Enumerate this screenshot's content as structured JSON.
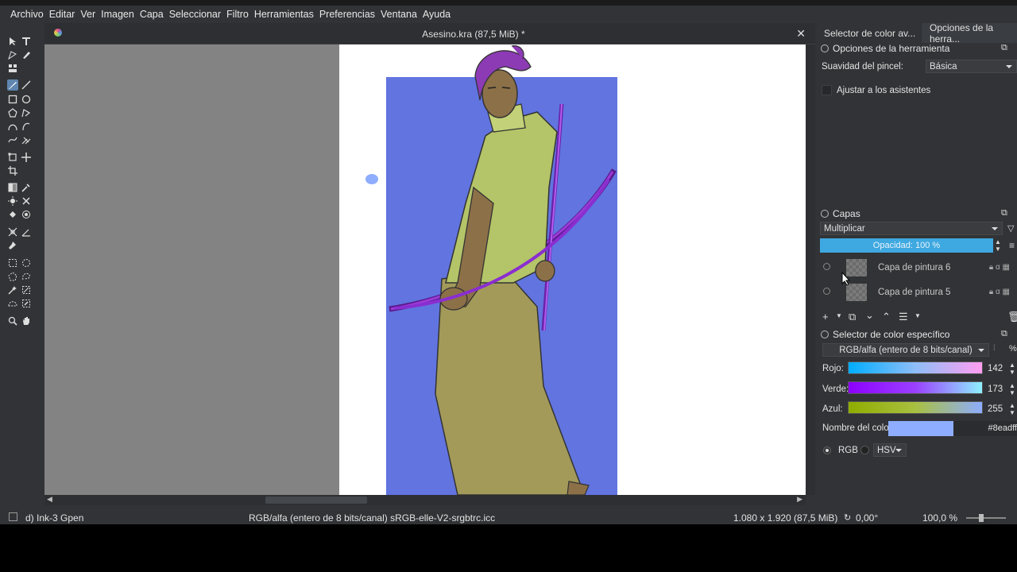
{
  "menu": [
    "Archivo",
    "Editar",
    "Ver",
    "Imagen",
    "Capa",
    "Seleccionar",
    "Filtro",
    "Herramientas",
    "Preferencias",
    "Ventana",
    "Ayuda"
  ],
  "document": {
    "title": "Asesino.kra (87,5 MiB) *"
  },
  "dock": {
    "tabs": [
      "Selector de color av...",
      "Opciones de la herra..."
    ],
    "tool_options": {
      "title": "Opciones de la herramienta",
      "smoothing_label": "Suavidad del pincel:",
      "smoothing_value": "Básica",
      "assistants_label": "Ajustar a los asistentes"
    },
    "layers": {
      "title": "Capas",
      "blend_mode": "Multiplicar",
      "opacity": "Opacidad: 100 %",
      "items": [
        "Capa de pintura 6",
        "Capa de pintura 5"
      ]
    },
    "color_selector": {
      "title": "Selector de color específico",
      "model": "RGB/alfa (entero de 8 bits/canal)",
      "percent_label": "%",
      "red_label": "Rojo:",
      "red_value": "142",
      "green_label": "Verde:",
      "green_value": "173",
      "blue_label": "Azul:",
      "blue_value": "255",
      "name_label": "Nombre del color:",
      "hex": "#8eadff",
      "swatch_color": "#8eadff",
      "rgb_label": "RGB",
      "hsv_label": "HSV"
    }
  },
  "status": {
    "brush": "d) Ink-3 Gpen",
    "colorspace": "RGB/alfa (entero de 8 bits/canal)  sRGB-elle-V2-srgbtrc.icc",
    "size": "1.080 x 1.920 (87,5 MiB)",
    "rotation": "0,00°",
    "zoom": "100,0 %"
  },
  "colors": {
    "accent": "#5f86b0",
    "canvas_blue": "#6174e0",
    "opacity_bar": "#3ea8e0"
  },
  "icons": [
    "select-shapes-icon",
    "text-icon",
    "edit-shapes-icon",
    "calligraphy-icon",
    "pattern-icon",
    "freehand-brush-icon",
    "line-icon",
    "rectangle-icon",
    "ellipse-icon",
    "polygon-icon",
    "polyline-icon",
    "bezier-icon",
    "freehand-path-icon",
    "dynamic-brush-icon",
    "multibrush-icon",
    "transform-icon",
    "move-icon",
    "crop-icon",
    "gradient-icon",
    "color-picker-icon",
    "smart-patch-icon",
    "fill-icon",
    "enclose-fill-icon",
    "assistant-icon",
    "measure-icon",
    "reference-icon",
    "rect-select-icon",
    "ellipse-select-icon",
    "polygon-select-icon",
    "freehand-select-icon",
    "contiguous-select-icon",
    "similar-select-icon",
    "bezier-select-icon",
    "magnetic-select-icon",
    "zoom-icon",
    "pan-icon"
  ]
}
